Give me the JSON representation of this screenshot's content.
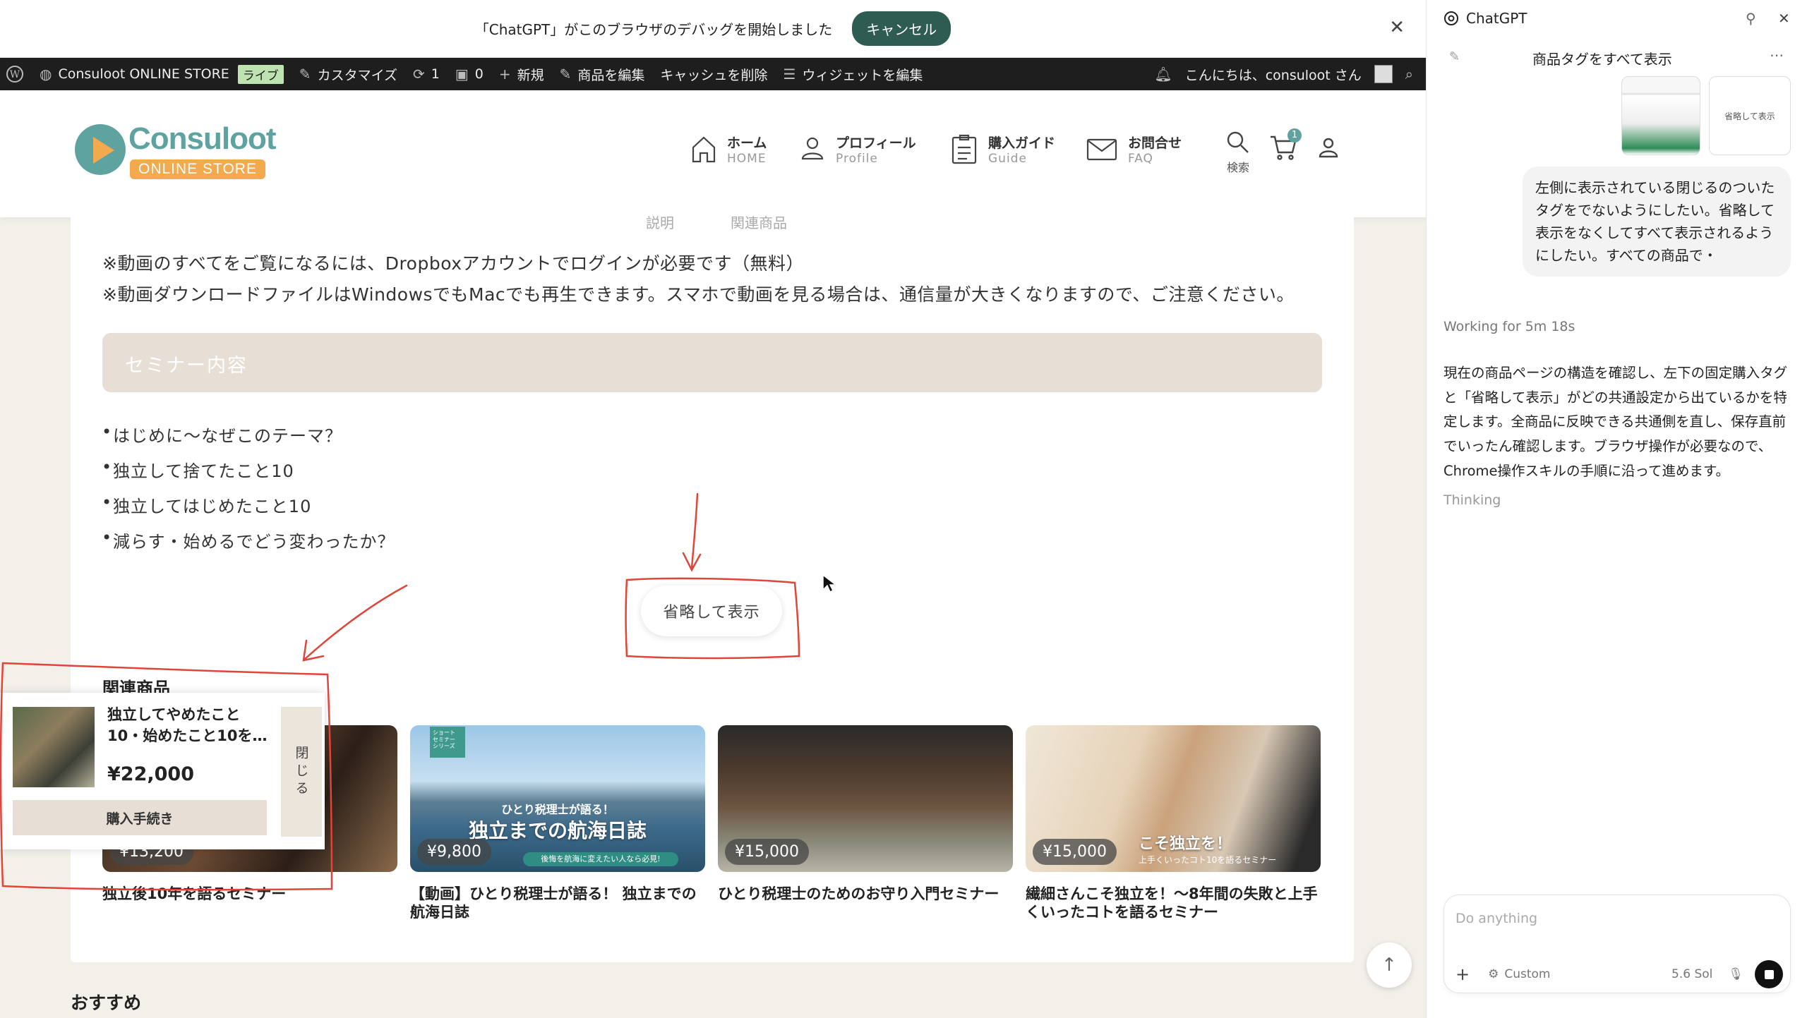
{
  "debug_banner": {
    "message": "「ChatGPT」がこのブラウザのデバッグを開始しました",
    "cancel_label": "キャンセル",
    "close": "✕"
  },
  "admin_bar": {
    "site_name": "Consuloot ONLINE STORE",
    "live_badge": "ライブ",
    "customize": "カスタマイズ",
    "updates_count": "1",
    "comments_count": "0",
    "new": "新規",
    "edit_product": "商品を編集",
    "clear_cache": "キャッシュを削除",
    "edit_widgets": "ウィジェットを編集",
    "greeting": "こんにちは、consuloot さん"
  },
  "header": {
    "logo_name": "Consuloot",
    "logo_sub": "ONLINE STORE",
    "nav": [
      {
        "label": "ホーム",
        "en": "HOME"
      },
      {
        "label": "プロフィール",
        "en": "Profile"
      },
      {
        "label": "購入ガイド",
        "en": "Guide"
      },
      {
        "label": "お問合せ",
        "en": "FAQ"
      }
    ],
    "search_label": "検索",
    "cart_count": "1"
  },
  "content": {
    "tabs": [
      "説明",
      "関連商品"
    ],
    "notes": [
      "※動画のすべてをご覧になるには、Dropboxアカウントでログインが必要です（無料）",
      "※動画ダウンロードファイルはWindowsでもMacでも再生できます。スマホで動画を見る場合は、通信量が大きくなりますので、ご注意ください。"
    ],
    "seminar_heading": "セミナー内容",
    "bullets": [
      "はじめに〜なぜこのテーマ？",
      "独立して捨てたこと10",
      "独立してはじめたこと10",
      "減らす・始めるでどう変わったか？"
    ],
    "more_button": "省略して表示",
    "related_heading": "関連商品",
    "related": [
      {
        "price": "¥13,200",
        "title": "独立後10年を語るセミナー"
      },
      {
        "price": "¥9,800",
        "title": "【動画】ひとり税理士が語る！ 独立までの航海日誌",
        "overlay_small": "ひとり税理士が語る！",
        "overlay_big": "独立までの航海日誌",
        "overlay_tag": "ショート\nセミナー\nシリーズ",
        "overlay_band": "後悔を航海に変えたい人なら必見!"
      },
      {
        "price": "¥15,000",
        "title": "ひとり税理士のためのお守り入門セミナー"
      },
      {
        "price": "¥15,000",
        "title": "繊細さんこそ独立を！〜8年間の失敗と上手くいったコトを語るセミナー",
        "overlay_big": "こそ独立を！",
        "overlay_band": "上手くいったコト10を語るセミナー"
      }
    ],
    "recommend_heading": "おすすめ"
  },
  "sticky_tag": {
    "name": "独立してやめたこと10・始めたこと10を…",
    "price": "¥22,000",
    "buy_label": "購入手続き",
    "close_label": "閉じる"
  },
  "chat": {
    "app_title": "ChatGPT",
    "chat_title": "商品タグをすべて表示",
    "thumb2_label": "省略して表示",
    "user_message": "左側に表示されている閉じるのついたタグをでないようにしたい。省略して表示をなくしてすべて表示されるようにしたい。すべての商品で・",
    "working": "Working for 5m 18s",
    "assistant_message": "現在の商品ページの構造を確認し、左下の固定購入タグと「省略して表示」がどの共通設定から出ているかを特定します。全商品に反映できる共通側を直し、保存直前でいったん確認します。ブラウザ操作が必要なので、Chrome操作スキルの手順に沿って進めます。",
    "thinking": "Thinking",
    "composer_placeholder": "Do anything",
    "mode_label": "Custom",
    "model_label": "5.6 Sol"
  },
  "colors": {
    "accent_teal": "#5fa3a0",
    "accent_orange": "#f3a94d",
    "beige": "#e7dfd5",
    "annotation_red": "#e0443a"
  }
}
